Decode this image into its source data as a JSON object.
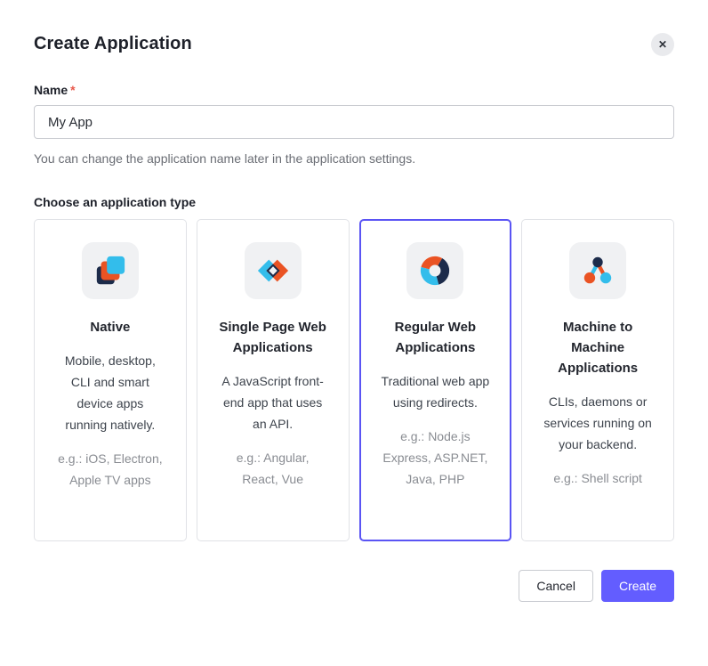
{
  "dialog": {
    "title": "Create Application",
    "close_glyph": "✕"
  },
  "form": {
    "name_label": "Name",
    "required_marker": "*",
    "name_value": "My App",
    "helper": "You can change the application name later in the application settings.",
    "type_label": "Choose an application type"
  },
  "app_types": [
    {
      "id": "native",
      "icon": "native-stacked-squares-icon",
      "title": "Native",
      "description": "Mobile, desktop, CLI and smart device apps running natively.",
      "examples": "e.g.: iOS, Electron, Apple TV apps",
      "selected": false
    },
    {
      "id": "spa",
      "icon": "single-page-app-diamonds-icon",
      "title": "Single Page Web Applications",
      "description": "A JavaScript front-end app that uses an API.",
      "examples": "e.g.: Angular, React, Vue",
      "selected": false
    },
    {
      "id": "regular-web",
      "icon": "regular-web-donut-icon",
      "title": "Regular Web Applications",
      "description": "Traditional web app using redirects.",
      "examples": "e.g.: Node.js Express, ASP.NET, Java, PHP",
      "selected": true
    },
    {
      "id": "m2m",
      "icon": "machine-to-machine-nodes-icon",
      "title": "Machine to Machine Applications",
      "description": "CLIs, daemons or services running on your backend.",
      "examples": "e.g.: Shell script",
      "selected": false
    }
  ],
  "footer": {
    "cancel_label": "Cancel",
    "create_label": "Create"
  },
  "colors": {
    "accent": "#635dff",
    "selected_border": "#5a54f4",
    "icon_navy": "#1c2b4a",
    "icon_orange": "#ea5323",
    "icon_cyan": "#33bdeb",
    "required_red": "#e8584b"
  }
}
